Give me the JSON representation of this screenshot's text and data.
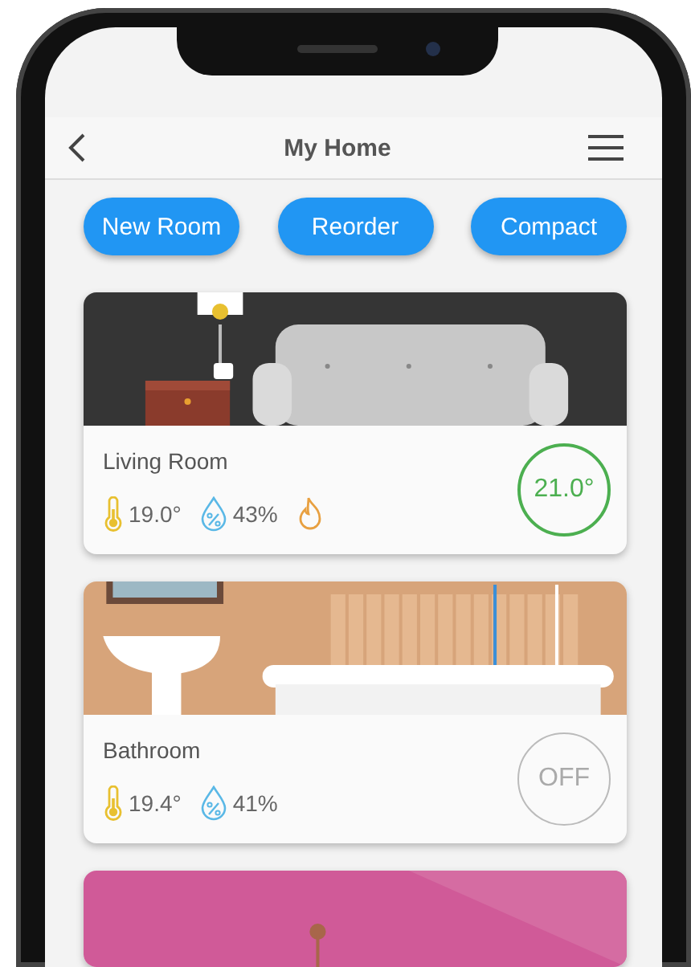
{
  "header": {
    "title": "My Home"
  },
  "actions": [
    {
      "label": "New Room"
    },
    {
      "label": "Reorder"
    },
    {
      "label": "Compact"
    }
  ],
  "rooms": [
    {
      "kind": "living",
      "name": "Living Room",
      "temperature": "19.0°",
      "humidity": "43%",
      "heating": true,
      "thermostat": {
        "label": "21.0°",
        "active": true
      }
    },
    {
      "kind": "bath",
      "name": "Bathroom",
      "temperature": "19.4°",
      "humidity": "41%",
      "heating": false,
      "thermostat": {
        "label": "OFF",
        "active": false
      }
    },
    {
      "kind": "pink"
    }
  ]
}
